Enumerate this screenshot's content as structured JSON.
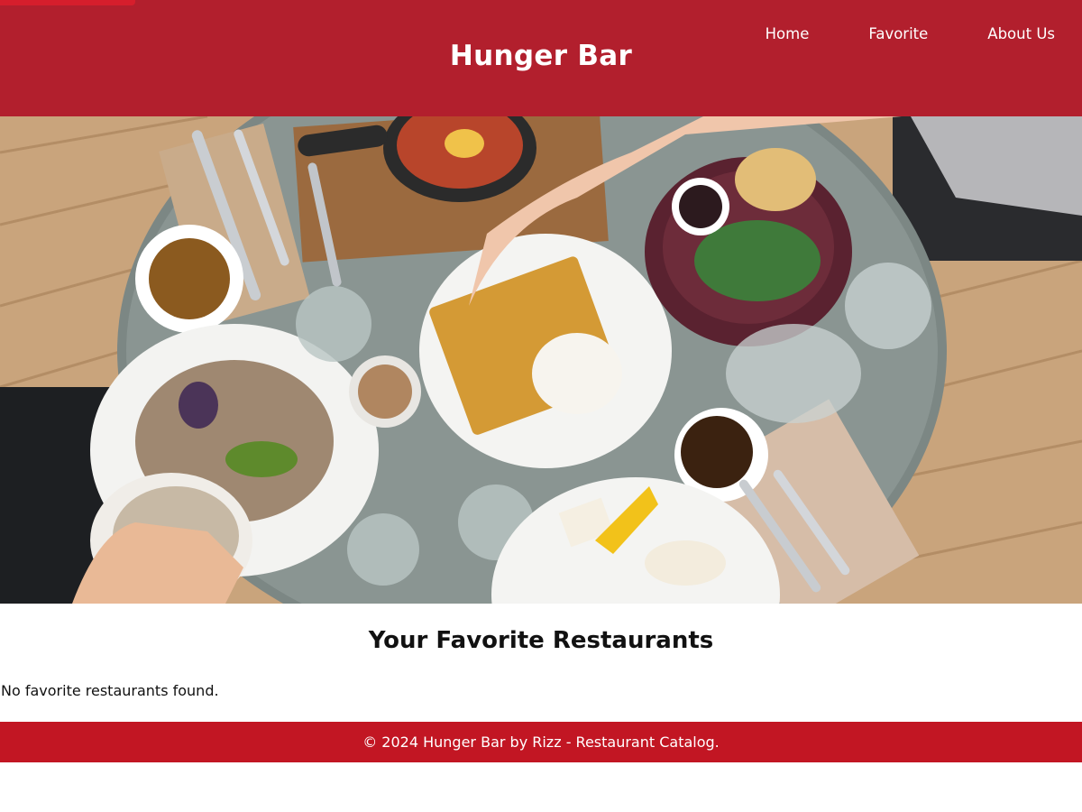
{
  "header": {
    "title": "Hunger Bar",
    "nav": [
      {
        "label": "Home"
      },
      {
        "label": "Favorite"
      },
      {
        "label": "About Us"
      }
    ]
  },
  "hero": {
    "image_subject": "brunch table photo"
  },
  "main": {
    "heading": "Your Favorite Restaurants",
    "empty_state": "No favorite restaurants found."
  },
  "footer": {
    "text": "© 2024 Hunger Bar by Rizz - Restaurant Catalog."
  },
  "colors": {
    "header_bg": "#b21f2d",
    "footer_bg": "#c21623",
    "skip_link": "#d61e2c"
  }
}
